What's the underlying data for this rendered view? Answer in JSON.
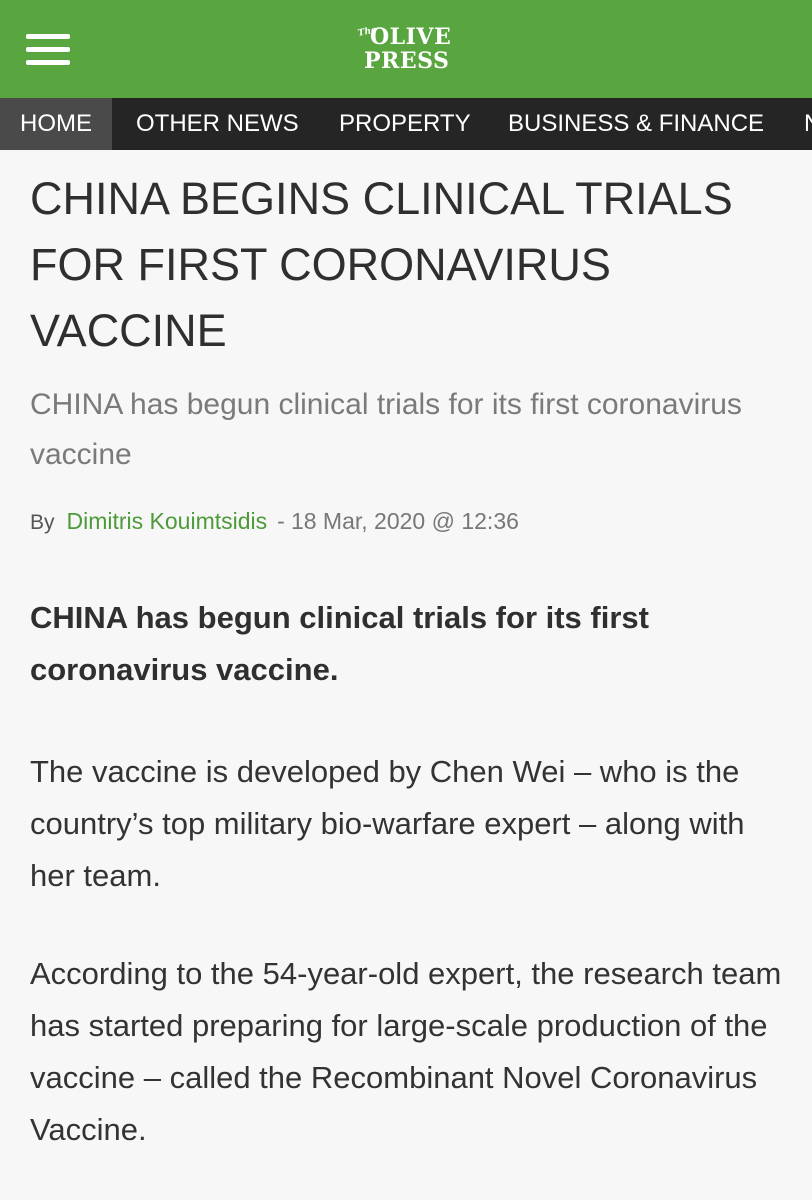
{
  "header": {
    "logo": {
      "the": "The",
      "line1": "OLIVE",
      "line2": "PRESS"
    },
    "menu_icon": "hamburger-menu-icon",
    "colors": {
      "header_bg": "#59a53f",
      "nav_bg": "#252525",
      "nav_active_bg": "#4a4a4a",
      "author_link": "#4d9a3a"
    }
  },
  "nav": {
    "items": [
      {
        "label": "HOME",
        "active": true
      },
      {
        "label": "OTHER NEWS"
      },
      {
        "label": "PROPERTY"
      },
      {
        "label": "BUSINESS & FINANCE"
      },
      {
        "label": "N"
      }
    ]
  },
  "article": {
    "title": "CHINA BEGINS CLINICAL TRIALS FOR FIRST CORONAVIRUS VACCINE",
    "subtitle": "CHINA has begun clinical trials for its first coronavirus vaccine",
    "byline": {
      "by": "By",
      "author": "Dimitris Kouimtsidis",
      "separator": "-",
      "date": "18 Mar, 2020 @ 12:36"
    },
    "lead": "CHINA has begun clinical trials for its first coronavirus vaccine.",
    "paragraphs": [
      "The vaccine is developed by Chen Wei – who is the country’s top military bio-warfare expert – along with her team.",
      "According to the 54-year-old expert, the research team has started preparing for large-scale production of the vaccine – called the Recombinant Novel Coronavirus Vaccine."
    ]
  }
}
